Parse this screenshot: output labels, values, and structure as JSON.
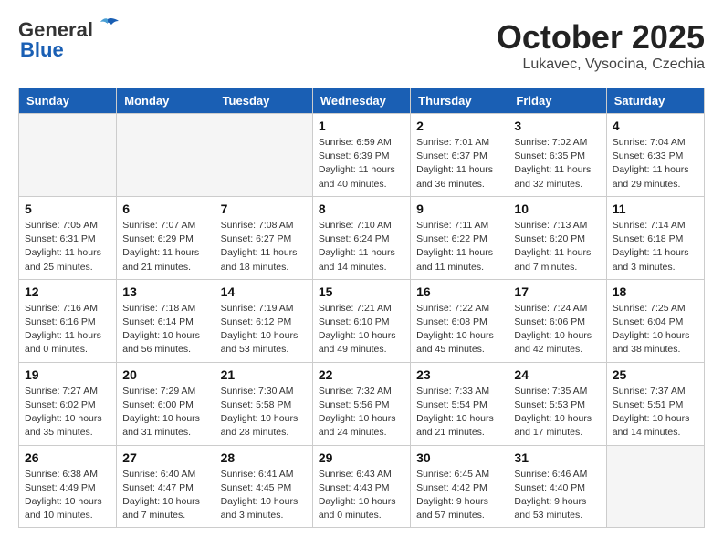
{
  "header": {
    "logo_general": "General",
    "logo_blue": "Blue",
    "month_title": "October 2025",
    "location": "Lukavec, Vysocina, Czechia"
  },
  "calendar": {
    "days_of_week": [
      "Sunday",
      "Monday",
      "Tuesday",
      "Wednesday",
      "Thursday",
      "Friday",
      "Saturday"
    ],
    "weeks": [
      [
        {
          "day": "",
          "info": ""
        },
        {
          "day": "",
          "info": ""
        },
        {
          "day": "",
          "info": ""
        },
        {
          "day": "1",
          "info": "Sunrise: 6:59 AM\nSunset: 6:39 PM\nDaylight: 11 hours\nand 40 minutes."
        },
        {
          "day": "2",
          "info": "Sunrise: 7:01 AM\nSunset: 6:37 PM\nDaylight: 11 hours\nand 36 minutes."
        },
        {
          "day": "3",
          "info": "Sunrise: 7:02 AM\nSunset: 6:35 PM\nDaylight: 11 hours\nand 32 minutes."
        },
        {
          "day": "4",
          "info": "Sunrise: 7:04 AM\nSunset: 6:33 PM\nDaylight: 11 hours\nand 29 minutes."
        }
      ],
      [
        {
          "day": "5",
          "info": "Sunrise: 7:05 AM\nSunset: 6:31 PM\nDaylight: 11 hours\nand 25 minutes."
        },
        {
          "day": "6",
          "info": "Sunrise: 7:07 AM\nSunset: 6:29 PM\nDaylight: 11 hours\nand 21 minutes."
        },
        {
          "day": "7",
          "info": "Sunrise: 7:08 AM\nSunset: 6:27 PM\nDaylight: 11 hours\nand 18 minutes."
        },
        {
          "day": "8",
          "info": "Sunrise: 7:10 AM\nSunset: 6:24 PM\nDaylight: 11 hours\nand 14 minutes."
        },
        {
          "day": "9",
          "info": "Sunrise: 7:11 AM\nSunset: 6:22 PM\nDaylight: 11 hours\nand 11 minutes."
        },
        {
          "day": "10",
          "info": "Sunrise: 7:13 AM\nSunset: 6:20 PM\nDaylight: 11 hours\nand 7 minutes."
        },
        {
          "day": "11",
          "info": "Sunrise: 7:14 AM\nSunset: 6:18 PM\nDaylight: 11 hours\nand 3 minutes."
        }
      ],
      [
        {
          "day": "12",
          "info": "Sunrise: 7:16 AM\nSunset: 6:16 PM\nDaylight: 11 hours\nand 0 minutes."
        },
        {
          "day": "13",
          "info": "Sunrise: 7:18 AM\nSunset: 6:14 PM\nDaylight: 10 hours\nand 56 minutes."
        },
        {
          "day": "14",
          "info": "Sunrise: 7:19 AM\nSunset: 6:12 PM\nDaylight: 10 hours\nand 53 minutes."
        },
        {
          "day": "15",
          "info": "Sunrise: 7:21 AM\nSunset: 6:10 PM\nDaylight: 10 hours\nand 49 minutes."
        },
        {
          "day": "16",
          "info": "Sunrise: 7:22 AM\nSunset: 6:08 PM\nDaylight: 10 hours\nand 45 minutes."
        },
        {
          "day": "17",
          "info": "Sunrise: 7:24 AM\nSunset: 6:06 PM\nDaylight: 10 hours\nand 42 minutes."
        },
        {
          "day": "18",
          "info": "Sunrise: 7:25 AM\nSunset: 6:04 PM\nDaylight: 10 hours\nand 38 minutes."
        }
      ],
      [
        {
          "day": "19",
          "info": "Sunrise: 7:27 AM\nSunset: 6:02 PM\nDaylight: 10 hours\nand 35 minutes."
        },
        {
          "day": "20",
          "info": "Sunrise: 7:29 AM\nSunset: 6:00 PM\nDaylight: 10 hours\nand 31 minutes."
        },
        {
          "day": "21",
          "info": "Sunrise: 7:30 AM\nSunset: 5:58 PM\nDaylight: 10 hours\nand 28 minutes."
        },
        {
          "day": "22",
          "info": "Sunrise: 7:32 AM\nSunset: 5:56 PM\nDaylight: 10 hours\nand 24 minutes."
        },
        {
          "day": "23",
          "info": "Sunrise: 7:33 AM\nSunset: 5:54 PM\nDaylight: 10 hours\nand 21 minutes."
        },
        {
          "day": "24",
          "info": "Sunrise: 7:35 AM\nSunset: 5:53 PM\nDaylight: 10 hours\nand 17 minutes."
        },
        {
          "day": "25",
          "info": "Sunrise: 7:37 AM\nSunset: 5:51 PM\nDaylight: 10 hours\nand 14 minutes."
        }
      ],
      [
        {
          "day": "26",
          "info": "Sunrise: 6:38 AM\nSunset: 4:49 PM\nDaylight: 10 hours\nand 10 minutes."
        },
        {
          "day": "27",
          "info": "Sunrise: 6:40 AM\nSunset: 4:47 PM\nDaylight: 10 hours\nand 7 minutes."
        },
        {
          "day": "28",
          "info": "Sunrise: 6:41 AM\nSunset: 4:45 PM\nDaylight: 10 hours\nand 3 minutes."
        },
        {
          "day": "29",
          "info": "Sunrise: 6:43 AM\nSunset: 4:43 PM\nDaylight: 10 hours\nand 0 minutes."
        },
        {
          "day": "30",
          "info": "Sunrise: 6:45 AM\nSunset: 4:42 PM\nDaylight: 9 hours\nand 57 minutes."
        },
        {
          "day": "31",
          "info": "Sunrise: 6:46 AM\nSunset: 4:40 PM\nDaylight: 9 hours\nand 53 minutes."
        },
        {
          "day": "",
          "info": ""
        }
      ]
    ]
  }
}
